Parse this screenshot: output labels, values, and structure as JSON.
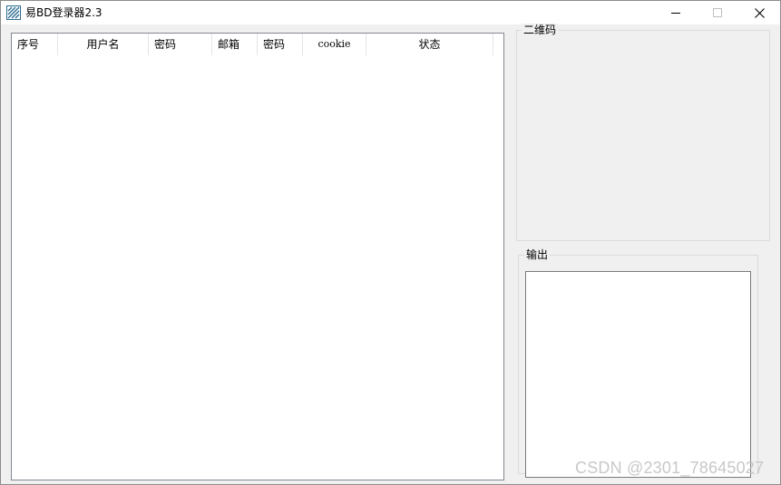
{
  "window": {
    "title": "易BD登录器2.3",
    "icon": "app-logo-icon"
  },
  "titlebar_buttons": {
    "minimize_icon": "minimize-icon",
    "maximize_icon": "maximize-icon",
    "close_icon": "close-icon"
  },
  "listview": {
    "columns": [
      "序号",
      "用户名",
      "密码",
      "邮箱",
      "密码",
      "cookie",
      "状态"
    ],
    "rows": []
  },
  "qr_group": {
    "label": "二维码"
  },
  "output_group": {
    "label": "输出",
    "value": ""
  },
  "watermark": "CSDN @2301_78645027",
  "colors": {
    "window_bg": "#f0f0f0",
    "list_bg": "#ffffff",
    "icon_accent": "#2a6b8f"
  }
}
